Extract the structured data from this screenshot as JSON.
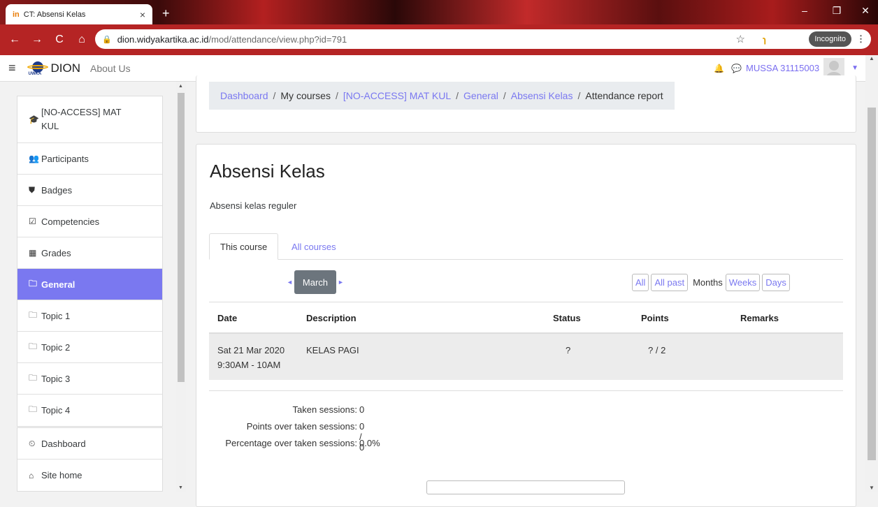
{
  "browser": {
    "tab_title": "CT: Absensi Kelas",
    "tab_favicon": "in",
    "url_domain": "dion.widyakartika.ac.id",
    "url_path": "/mod/attendance/view.php?id=791",
    "incognito_label": "Incognito"
  },
  "navbar": {
    "brand": "DION",
    "brand_sub": "UWKA",
    "about": "About Us",
    "user": "MUSSA 31115003"
  },
  "sidebar": {
    "course": [
      "[NO-ACCESS] MAT",
      "KUL"
    ],
    "group1": [
      {
        "label": "Participants",
        "icon": "users-icon",
        "glyph": "👥"
      },
      {
        "label": "Badges",
        "icon": "shield-icon",
        "glyph": "⛊"
      },
      {
        "label": "Competencies",
        "icon": "check-square-icon",
        "glyph": "☑"
      },
      {
        "label": "Grades",
        "icon": "table-icon",
        "glyph": "▦"
      },
      {
        "label": "General",
        "icon": "folder-icon",
        "glyph": "🗀"
      },
      {
        "label": "Topic 1",
        "icon": "folder-icon",
        "glyph": "🗀"
      },
      {
        "label": "Topic 2",
        "icon": "folder-icon",
        "glyph": "🗀"
      },
      {
        "label": "Topic 3",
        "icon": "folder-icon",
        "glyph": "🗀"
      },
      {
        "label": "Topic 4",
        "icon": "folder-icon",
        "glyph": "🗀"
      }
    ],
    "group2": [
      {
        "label": "Dashboard",
        "icon": "dashboard-icon",
        "glyph": "⏲"
      },
      {
        "label": "Site home",
        "icon": "home-icon",
        "glyph": "⌂"
      }
    ]
  },
  "breadcrumb": {
    "items": [
      "Dashboard",
      "My courses",
      "[NO-ACCESS] MAT KUL",
      "General",
      "Absensi Kelas"
    ],
    "current": "Attendance report"
  },
  "main": {
    "title": "Absensi Kelas",
    "intro": "Absensi kelas reguler",
    "tabs": [
      "This course",
      "All courses"
    ],
    "month": "March",
    "views": [
      "All",
      "All past",
      "Months",
      "Weeks",
      "Days"
    ],
    "columns": [
      "Date",
      "Description",
      "Status",
      "Points",
      "Remarks"
    ],
    "row": {
      "date": "Sat 21 Mar 2020",
      "time": "9:30AM - 10AM",
      "description": "KELAS PAGI",
      "status": "?",
      "points": "? / 2",
      "remarks": ""
    },
    "summary": [
      {
        "label": "Taken sessions:",
        "value": "0"
      },
      {
        "label": "Points over taken sessions:",
        "value": "0 / 0"
      },
      {
        "label": "Percentage over taken sessions:",
        "value": "0.0%"
      }
    ]
  },
  "colors": {
    "accent": "#7a78f0",
    "browser_frame": "#b52424",
    "active_item": "#7a78f0"
  }
}
